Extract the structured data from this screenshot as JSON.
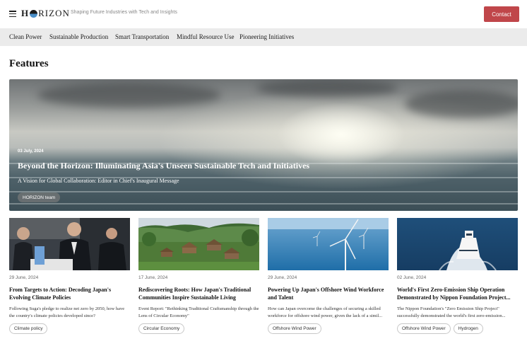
{
  "header": {
    "logo": "HORIZON",
    "tagline": "Shaping Future Industries with Tech and Insights",
    "contact_label": "Contact"
  },
  "nav": {
    "items": [
      {
        "label": "Clean Power"
      },
      {
        "label": "Sustainable Production"
      },
      {
        "label": "Smart Transportation"
      },
      {
        "label": "Mindful Resource Use"
      },
      {
        "label": "Pioneering Initiatives"
      }
    ]
  },
  "section_title": "Features",
  "hero": {
    "date": "03 July, 2024",
    "title": "Beyond the Horizon: Illuminating Asia's Unseen Sustainable Tech and Initiatives",
    "subtitle": "A Vision for Global Collaboration: Editor in Chief's Inaugural Message",
    "tag": "HORIZON team"
  },
  "cards": [
    {
      "date": "29 June, 2024",
      "title": "From Targets to Action: Decoding Japan's Evolving Climate Policies",
      "desc": "Following Suga's pledge to realize net zero by 2050, how have the country's climate policies developed since?",
      "tags": [
        "Climate policy"
      ]
    },
    {
      "date": "17 June, 2024",
      "title": "Rediscovering Roots: How Japan's Traditional Communities Inspire Sustainable Living",
      "desc": "Event Report: \"Rethinking Traditional Craftsmanship through the Lens of Circular Economy\"",
      "tags": [
        "Circular Economy"
      ]
    },
    {
      "date": "29 June, 2024",
      "title": "Powering Up Japan's Offshore Wind Workforce and Talent",
      "desc": "How can Japan overcome the challenges of securing a skilled workforce for offshore wind power, given the lack of a simil...",
      "tags": [
        "Offshore Wind Power"
      ]
    },
    {
      "date": "02 June, 2024",
      "title": "World's First Zero-Emission Ship Operation Demonstrated by Nippon Foundation Project...",
      "desc": "The Nippon Foundation's \"Zero Emission Ship Project\" successfully demonstrated the world's first zero-emission...",
      "tags": [
        "Offshore Wind Power",
        "Hydrogen"
      ]
    }
  ],
  "colors": {
    "accent": "#c0464a",
    "nav_bg": "#ebebeb"
  }
}
